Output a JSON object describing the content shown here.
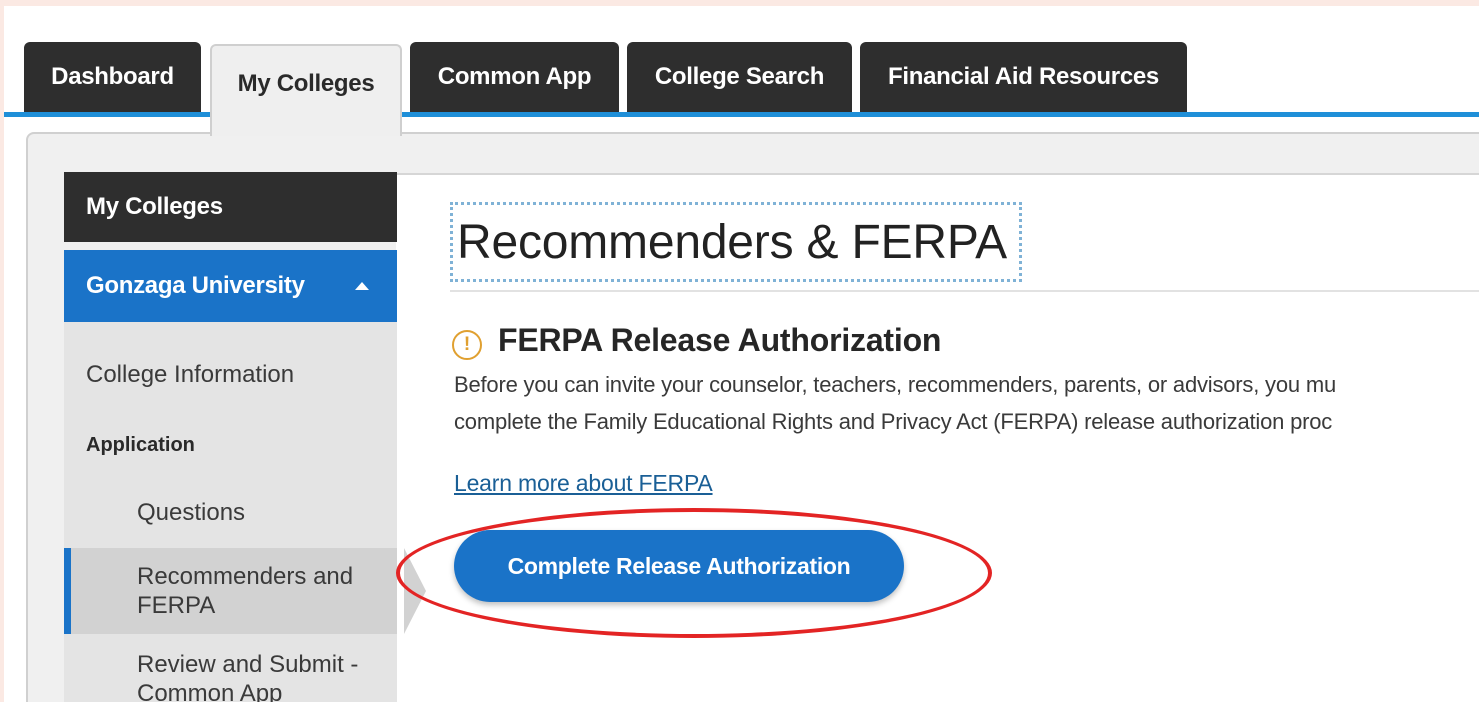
{
  "tabs": [
    {
      "label": "Dashboard"
    },
    {
      "label": "My Colleges"
    },
    {
      "label": "Common App"
    },
    {
      "label": "College Search"
    },
    {
      "label": "Financial Aid Resources"
    }
  ],
  "sidebar": {
    "header": "My Colleges",
    "college": "Gonzaga University",
    "items": {
      "college_info": "College Information",
      "section_application": "Application",
      "questions": "Questions",
      "recommenders_line1": "Recommenders and",
      "recommenders_line2": "FERPA",
      "review_line1": "Review and Submit -",
      "review_line2": "Common App"
    }
  },
  "main": {
    "title": "Recommenders & FERPA",
    "section_heading": "FERPA Release Authorization",
    "warning_glyph": "!",
    "paragraph_line1": "Before you can invite your counselor, teachers, recommenders, parents, or advisors, you mu",
    "paragraph_line2": "complete the Family Educational Rights and Privacy Act (FERPA) release authorization proc",
    "learn_more": "Learn more about FERPA",
    "cta": "Complete Release Authorization"
  },
  "colors": {
    "accent": "#1a73c8",
    "tab_dark": "#2e2e2e",
    "annotation": "#e32424",
    "warning": "#e0a030"
  },
  "icons": {
    "warning": "warning-circle-icon",
    "collapse": "caret-up-icon"
  }
}
